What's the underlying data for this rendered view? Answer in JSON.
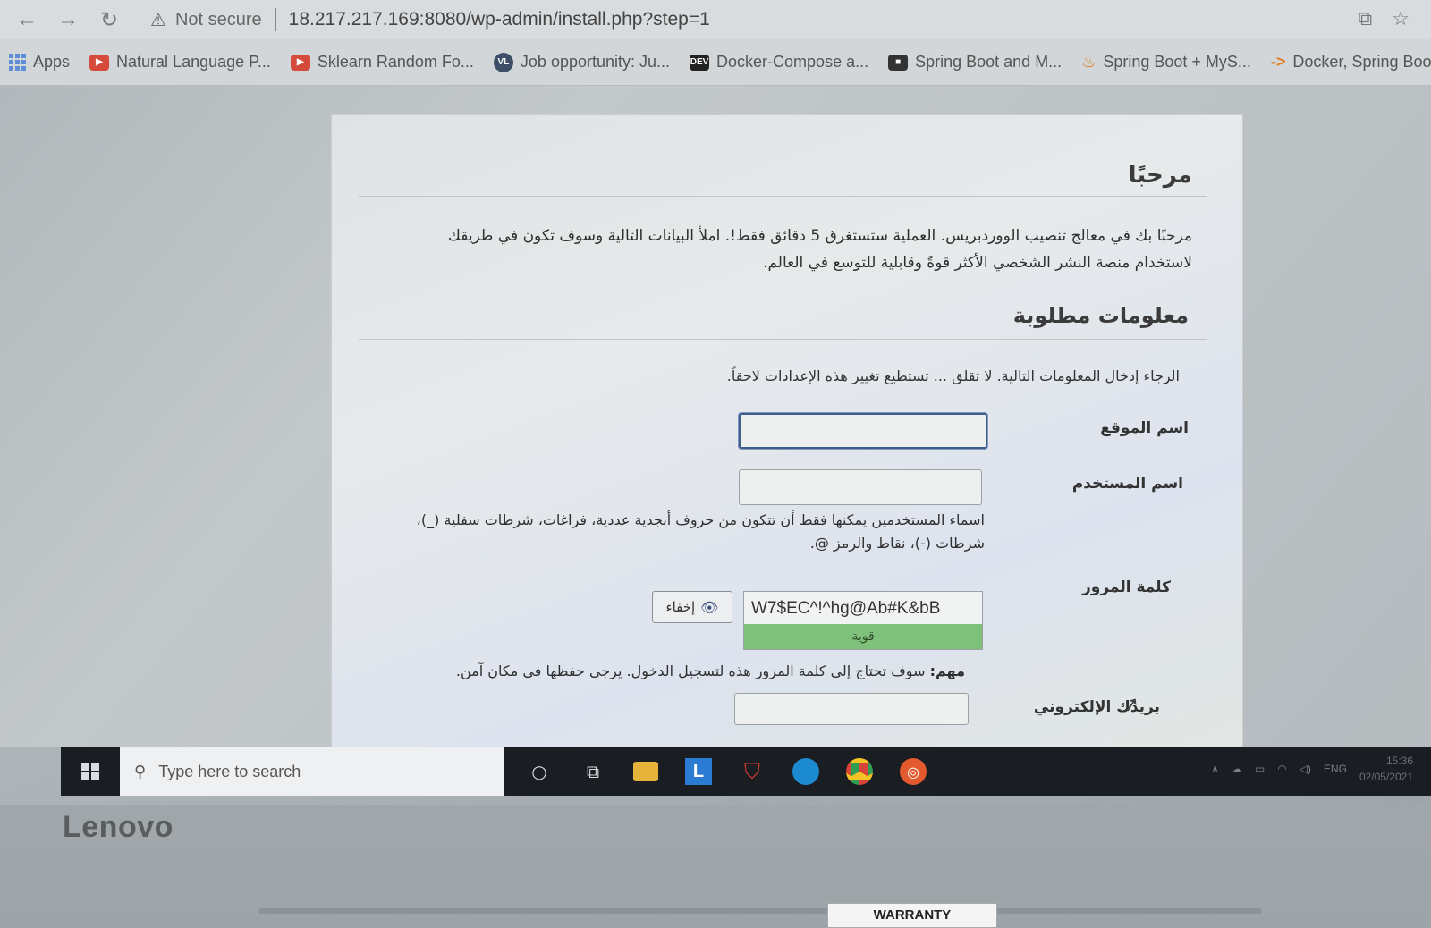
{
  "browser": {
    "security_label": "Not secure",
    "url": "18.217.217.169:8080/wp-admin/install.php?step=1",
    "bookmarks": [
      {
        "label": "Apps"
      },
      {
        "label": "Natural Language P..."
      },
      {
        "label": "Sklearn Random Fo..."
      },
      {
        "label": "Job opportunity: Ju..."
      },
      {
        "label": "Docker-Compose a..."
      },
      {
        "label": "Spring Boot and M..."
      },
      {
        "label": "Spring Boot + MyS..."
      },
      {
        "label": "Docker, Spring Boo..."
      }
    ],
    "bookmark_badges": {
      "vl": "VL",
      "dev": "DEV"
    }
  },
  "page": {
    "welcome_title": "مرحبًا",
    "intro_text": "مرحبًا بك في معالج تنصيب الووردبريس. العملية ستستغرق 5 دقائق فقط!. املأ البيانات التالية وسوف تكون في طريقك لاستخدام منصة النشر الشخصي الأكثر قوةً وقابلية للتوسع في العالم.",
    "required_title": "معلومات مطلوبة",
    "note_text": "الرجاء إدخال المعلومات التالية. لا تقلق ... تستطيع تغيير هذه الإعدادات لاحقاً.",
    "site_name_label": "اسم الموقع",
    "username_label": "اسم المستخدم",
    "username_help": "اسماء المستخدمين يمكنها فقط أن تتكون من حروف أبجدية عددية، فراغات، شرطات سفلية (_)، شرطات (-)، نقاط والرمز @.",
    "password_label": "كلمة المرور",
    "password_value": "W7$EC^!^hg@Ab#K&bB",
    "password_strength": "قوية",
    "hide_button": "إخفاء",
    "important_label": "مهم:",
    "important_text": "سوف تحتاج إلى كلمة المرور هذه لتسجيل الدخول. يرجى حفظها في مكان آمن.",
    "email_label": "بريدك الإلكتروني"
  },
  "taskbar": {
    "search_placeholder": "Type here to search",
    "lang": "ENG",
    "time": "15:36",
    "date": "02/05/2021"
  },
  "laptop": {
    "brand": "Lenovo",
    "sticker": "WARRANTY PROTECTION"
  },
  "colors": {
    "strength_bar": "#7fc17a",
    "focus_border": "#3d5d8a",
    "taskbar_bg": "#1a1d22"
  }
}
